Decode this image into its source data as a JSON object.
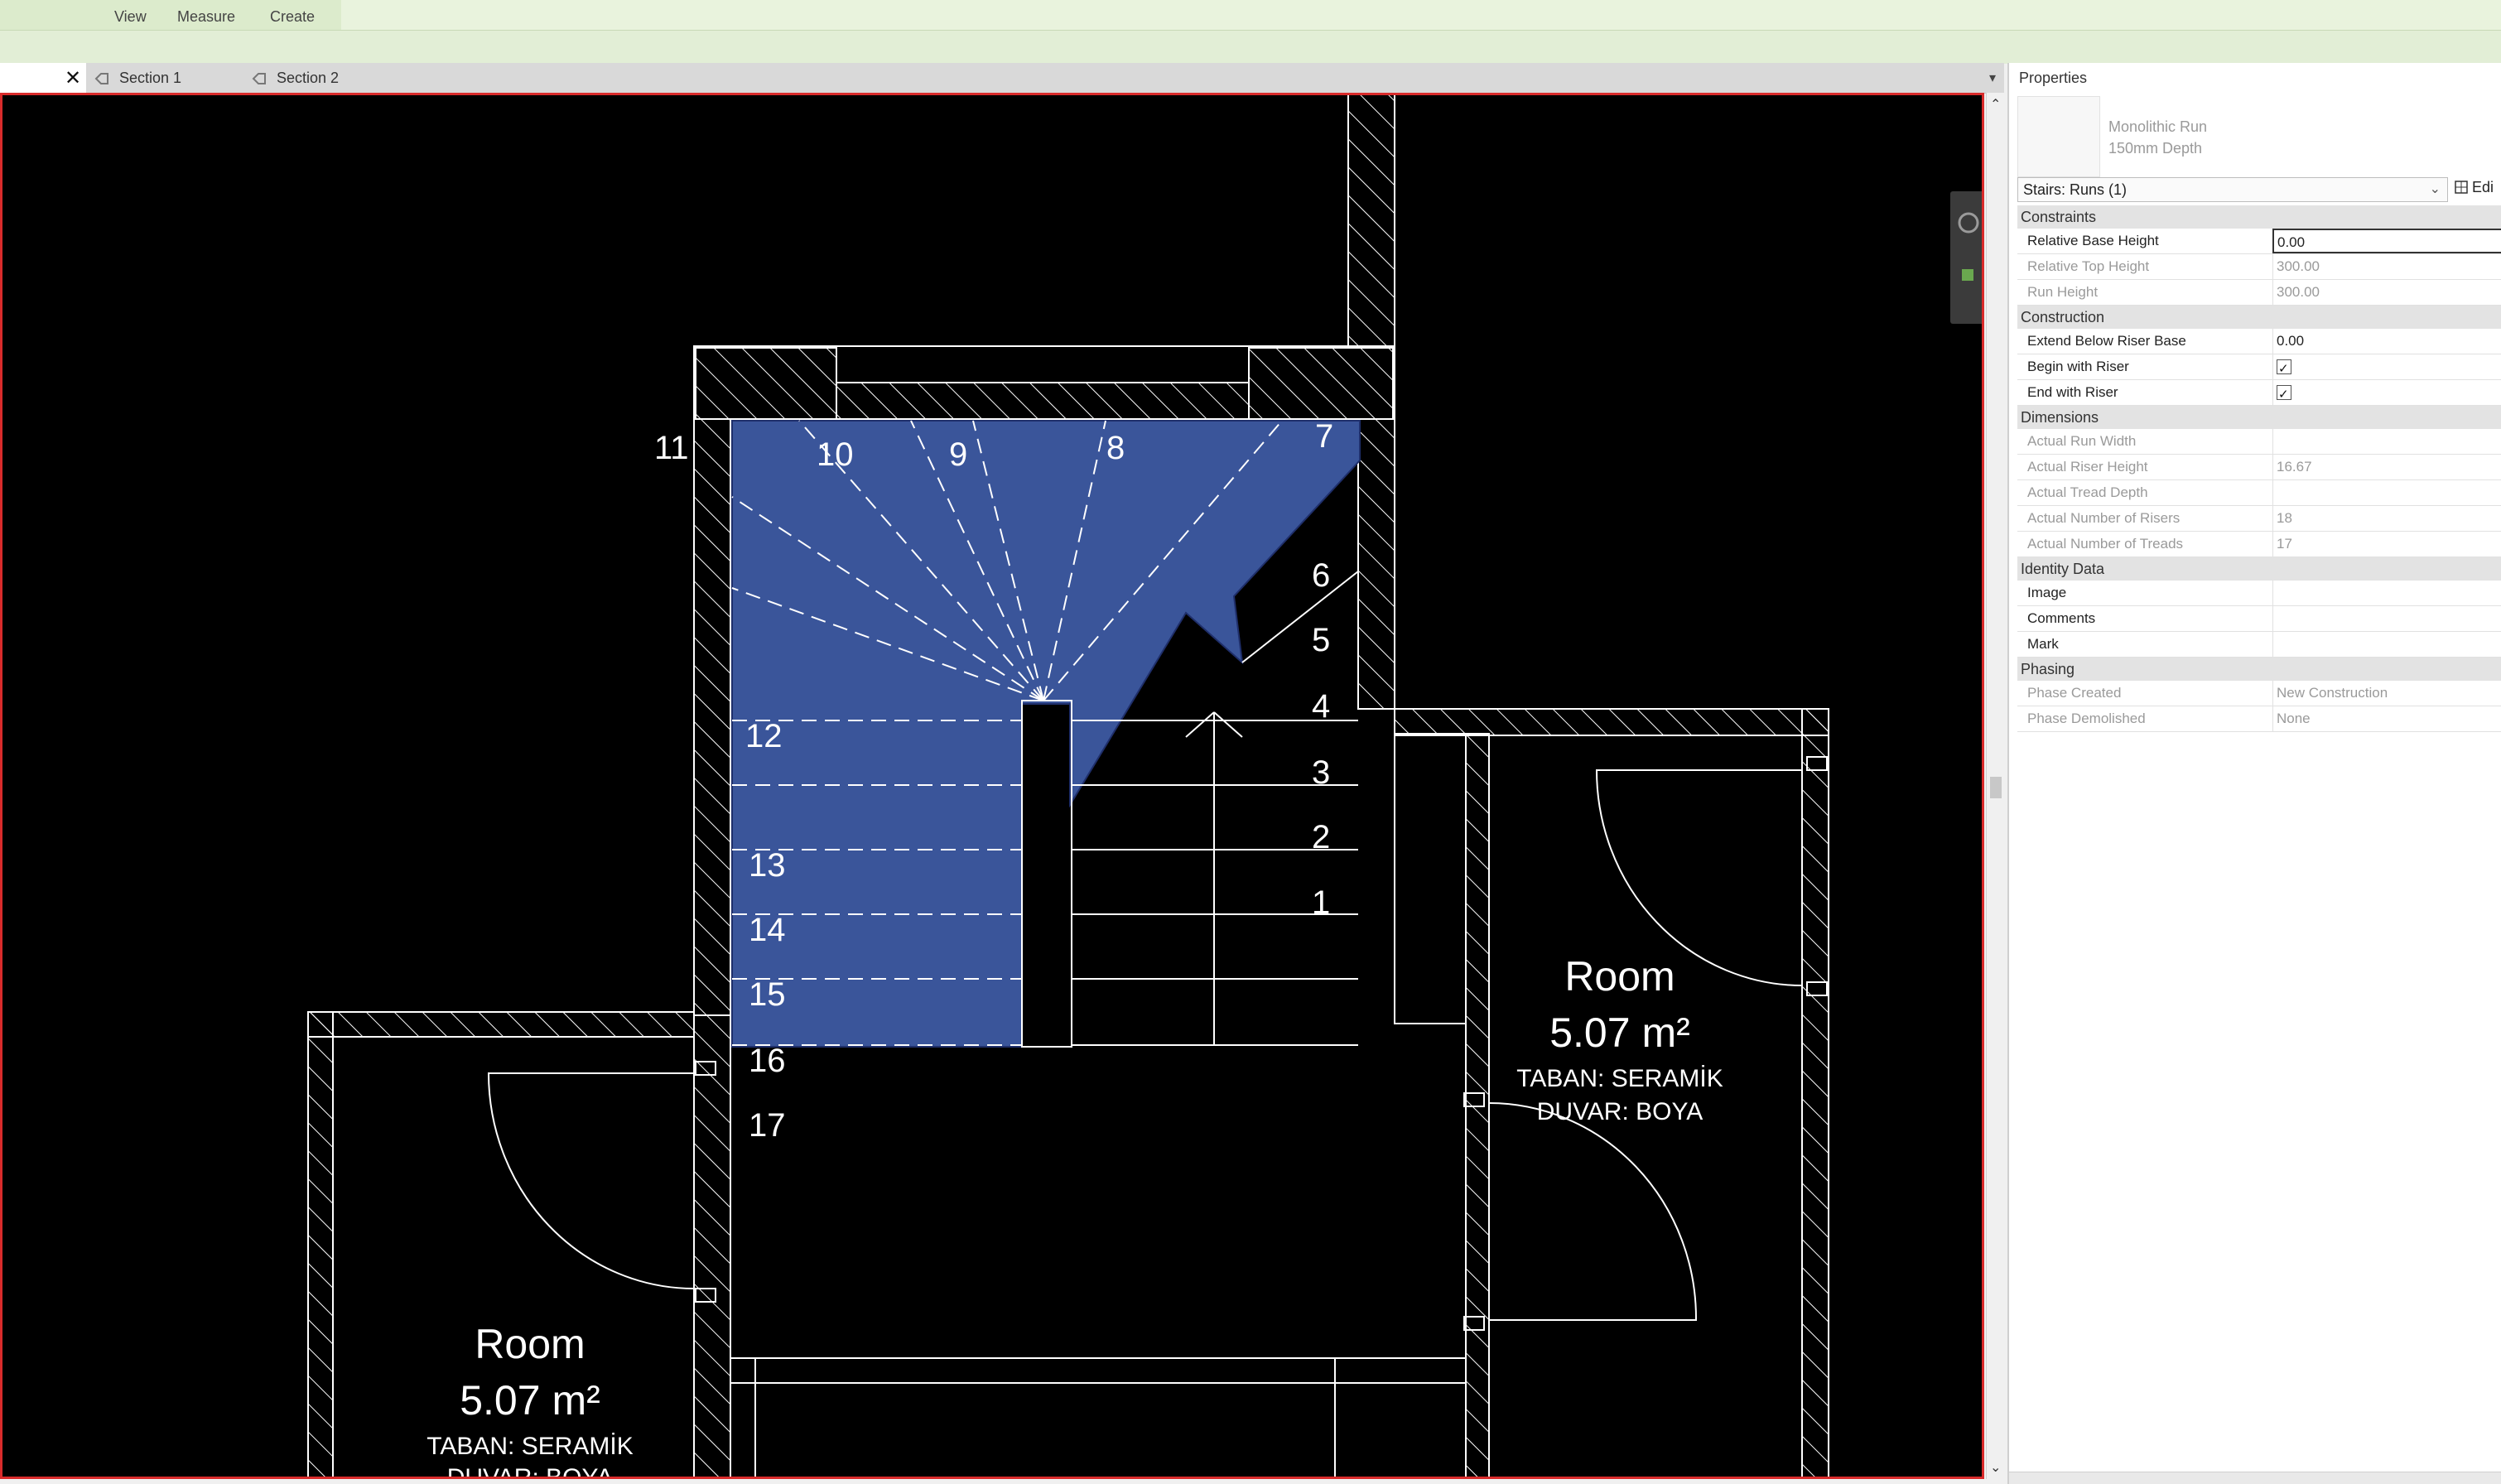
{
  "ribbon": {
    "panels": [
      {
        "label": "View"
      },
      {
        "label": "Measure"
      },
      {
        "label": "Create"
      }
    ]
  },
  "tabs": {
    "items": [
      {
        "label": "Section 1"
      },
      {
        "label": "Section 2"
      }
    ]
  },
  "drawing": {
    "step_numbers": [
      "1",
      "2",
      "3",
      "4",
      "5",
      "6",
      "7",
      "8",
      "9",
      "10",
      "11",
      "12",
      "13",
      "14",
      "15",
      "16",
      "17"
    ],
    "room_right": {
      "name": "Room",
      "area": "5.07 m²",
      "floor": "TABAN: SERAMİK",
      "wall": "DUVAR: BOYA"
    },
    "room_left": {
      "name": "Room",
      "area": "5.07 m²",
      "floor": "TABAN: SERAMİK",
      "wall": "DUVAR: BOYA"
    },
    "colors": {
      "stair_fill": "#3a559a",
      "lines": "#ffffff",
      "background": "#000000"
    }
  },
  "properties": {
    "title": "Properties",
    "type_name_line1": "Monolithic Run",
    "type_name_line2": "150mm Depth",
    "selector": "Stairs: Runs (1)",
    "edit_type": "Edi",
    "groups": [
      {
        "name": "Constraints",
        "rows": [
          {
            "name": "Relative Base Height",
            "value": "0.00"
          },
          {
            "name": "Relative Top Height",
            "value": "300.00"
          },
          {
            "name": "Run Height",
            "value": "300.00"
          }
        ]
      },
      {
        "name": "Construction",
        "rows": [
          {
            "name": "Extend Below Riser Base",
            "value": "0.00"
          },
          {
            "name": "Begin with Riser",
            "value": ""
          },
          {
            "name": "End with Riser",
            "value": ""
          }
        ]
      },
      {
        "name": "Dimensions",
        "rows": [
          {
            "name": "Actual Run Width",
            "value": ""
          },
          {
            "name": "Actual Riser Height",
            "value": "16.67"
          },
          {
            "name": "Actual Tread Depth",
            "value": ""
          },
          {
            "name": "Actual Number of Risers",
            "value": "18"
          },
          {
            "name": "Actual Number of Treads",
            "value": "17"
          }
        ]
      },
      {
        "name": "Identity Data",
        "rows": [
          {
            "name": "Image",
            "value": ""
          },
          {
            "name": "Comments",
            "value": ""
          },
          {
            "name": "Mark",
            "value": ""
          }
        ]
      },
      {
        "name": "Phasing",
        "rows": [
          {
            "name": "Phase Created",
            "value": "New Construction"
          },
          {
            "name": "Phase Demolished",
            "value": "None"
          }
        ]
      }
    ]
  }
}
